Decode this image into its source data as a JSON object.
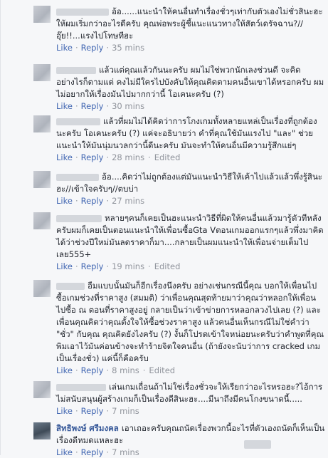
{
  "comments": [
    {
      "text": "อ้อ......แนะนำให้คนอื่นทำเรื่องชั่วๆเท่ากับตัวเองไม่ชั่วสินะฮะ ให้ผมเริ่มกว่าอะไรดีครับ คุณพ่อพระผู้ชี้แนะแนวทางให้สัตว์เดรัจฉาน?// อุ๊ย!!...แรงไปโทษทีฮะ",
      "like": "Like",
      "reply": "Reply",
      "time": "35 mins",
      "edited": ""
    },
    {
      "text": "แล้วแต่คุณแล้วกันนะครับ ผมไม่ใช่พวกนักเลงช่วนดี จะคิดอย่างไรก็ตามแต่ คงไม่มีใครไปบังคับให้คุณคิดตามคนอื่นเขาได้หรอกครับ ผมไม่อยากให้เรื่องมันไปมากกว่านี้ โอเคนะครับ (?)",
      "like": "Like",
      "reply": "Reply",
      "time": "30 mins",
      "edited": ""
    },
    {
      "text": "แล้วที่ผมไม่ได้คิดว่าการโกงเกมทั้งหลายแหล่เป็นเรื่องที่ถูกต้องนะครับ โอเคนะครับ (?) แค่จะอธิบายว่า คำที่คุณใช้มันแรงไป \"และ\" ช่วยแนะนำให้มันนุ่มนวลกว่านี้ดีนะครับ มันจะทำให้คนอื่นมีความรู้สึกแย่ๆ",
      "like": "Like",
      "reply": "Reply",
      "time": "28 mins",
      "edited": "Edited"
    },
    {
      "text": "อ้อ....คิดว่าไม่ถูกต้องแต่มันแนะนำวิธีให้เค้าไปแล้วแล้วพึ่งรู้สินะฮะ//เข้าใจครับๆ//ตบบ่า",
      "like": "Like",
      "reply": "Reply",
      "time": "27 mins",
      "edited": ""
    },
    {
      "text": "หลายๆคนก็เคยเป็นฮะแนะนำวิธีที่ผิดให้คนอื่นแล้วมารู้ตัวทีหลังครับผมก็เคยเป็นตอนแนะนำให้เพื่อนซื้อGta Vตอนเกมออกแรกๆแล้วพึ่งมาคิดได้ว่าช่วงปีใหม่มันลดราคาก็มา....กลายเป็นผมแนะนำให้เพื่อนจ่ายเต็มไปเลย555+",
      "like": "Like",
      "reply": "Reply",
      "time": "19 mins",
      "edited": "Edited"
    },
    {
      "text": "อืมแบบนั้นมันก็อีกเรื่องนึงครับ อย่างเช่นกรณีนี้คุณ บอกให้เพื่อนไปซื้อเกมช่วงที่ราคาสูง (สมมติ) ว่าเพื่อนคุณสุดท้ายมาว่าคุณว่าหลอกให้เพื่อนไปซื้อ ณ ตอนที่ราคาสูงอยู่ กลายเป็นว่าเข้าข่ายการหลอกลวงไปเลย (?) และเพื่อนคุณคิดว่าคุณตั้งใจให้ซื้อช่วงราคาสูง แล้วคนอื่นเห็นกรณีไม่ใช่คำว่า \"ชั่ว\" กับคุณ คุณคิดยังไงครับ (?) งั้นก็โปรดเข้าใจหน่อยนะครับว่าคำพูดที่คุณพิมเอาไว้มันค่อนข้างจะทำร้ายจิตใจคนอื่น (ถ้ายังจะนับว่าการ cracked เกมเป็นเรื่องชั่ว) แค่นี้ก็คือครับ",
      "like": "Like",
      "reply": "Reply",
      "time": "8 mins",
      "edited": "Edited"
    },
    {
      "text": "เล่นเกมเถื่อนถ้าไม่ใช่เรื่องชั่วจะให้เรียกว่าอะไรหรอฮะ?ไอ้การไม่สนับสนุนผู้สร้างเกมก็เป็นเรื่องดีสินะฮะ....มีนาถึงมีคนโกงขนาดนี้.....",
      "like": "Like",
      "reply": "Reply",
      "time": "7 mins",
      "edited": ""
    },
    {
      "name": "สิทธิพงษ์ ศรีมงคล",
      "text": "เอาเถอะครับคุณถนัดเรื่องพวกนี้อะไรที่ตัวเองถนัดก็เห็นเป็นเรื่องดีหมดแหละฮะ",
      "like": "Like",
      "reply": "Reply",
      "time": "7 mins",
      "edited": ""
    }
  ]
}
